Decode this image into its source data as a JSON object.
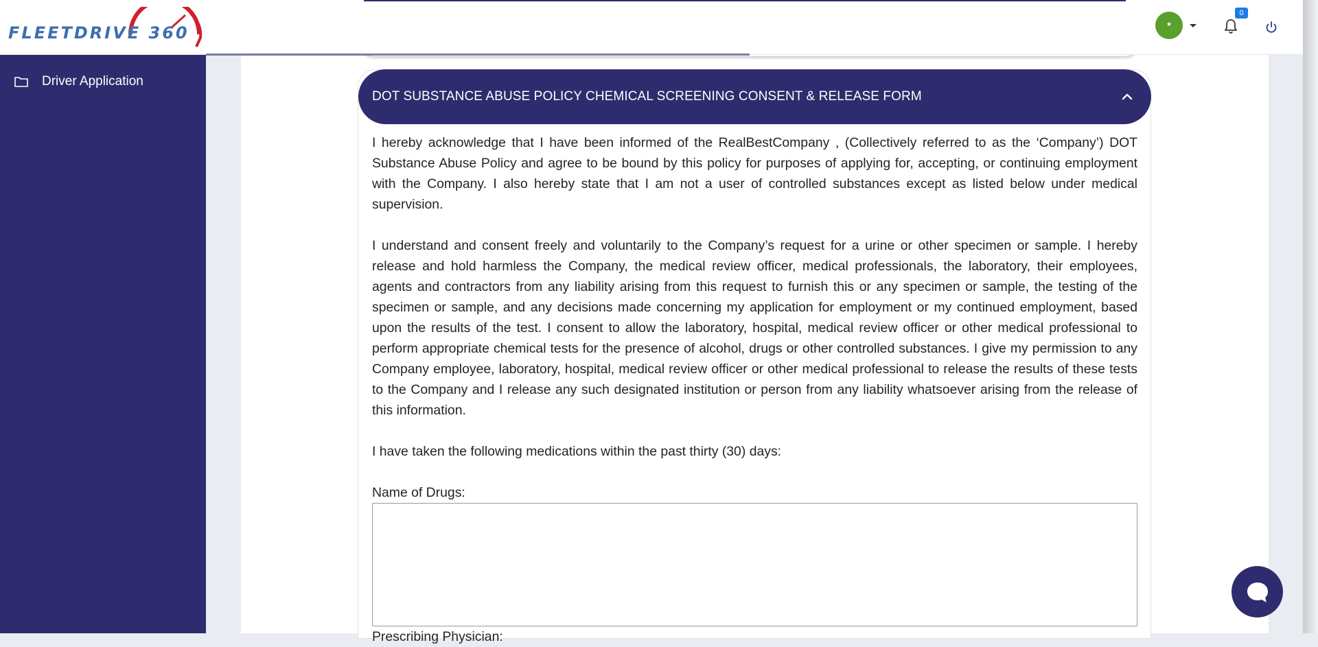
{
  "header": {
    "logo": {
      "text": "FLEETDRIVE ",
      "number": "360"
    },
    "avatar_initial": "*",
    "notification_count": "0",
    "icons": [
      "user-avatar",
      "caret-down-icon",
      "bell-icon",
      "power-icon"
    ]
  },
  "sidebar": {
    "items": [
      {
        "icon": "folder-icon",
        "label": "Driver Application"
      }
    ]
  },
  "panel": {
    "title": "DOT SUBSTANCE ABUSE POLICY CHEMICAL SCREENING CONSENT & RELEASE FORM",
    "paragraphs": [
      "I hereby acknowledge that I have been informed of the RealBestCompany , (Collectively referred to as the ‘Company’) DOT Substance Abuse Policy and agree to be bound by this policy for purposes of applying for, accepting, or continuing employment with the Company. I also hereby state that I am not a user of controlled substances except as listed below under medical supervision.",
      "I understand and consent freely and voluntarily to the Company’s request for a urine or other specimen or sample. I hereby release and hold harmless the Company, the medical review officer, medical professionals, the laboratory, their employees, agents and contractors from any liability arising from this request to furnish this or any specimen or sample, the testing of the specimen or sample, and any decisions made concerning my application for employment or my continued employment, based upon the results of the test. I consent to allow the laboratory, hospital, medical review officer or other medical professional to perform appropriate chemical tests for the presence of alcohol, drugs or other controlled substances. I give my permission to any Company employee, laboratory, hospital, medical review officer or other medical professional to release the results of these tests to the Company and I release any such designated institution or person from any liability whatsoever arising from the release of this information.",
      "I have taken the following medications within the past thirty (30) days:"
    ],
    "drugs_label": "Name of Drugs:",
    "drugs_value": "",
    "physician_label": "Prescribing Physician:"
  },
  "colors": {
    "primary": "#2e2c6e",
    "avatar": "#5aa02c",
    "badge": "#1e7be6",
    "logo_blue": "#3e6fae",
    "logo_red": "#d0202e"
  }
}
